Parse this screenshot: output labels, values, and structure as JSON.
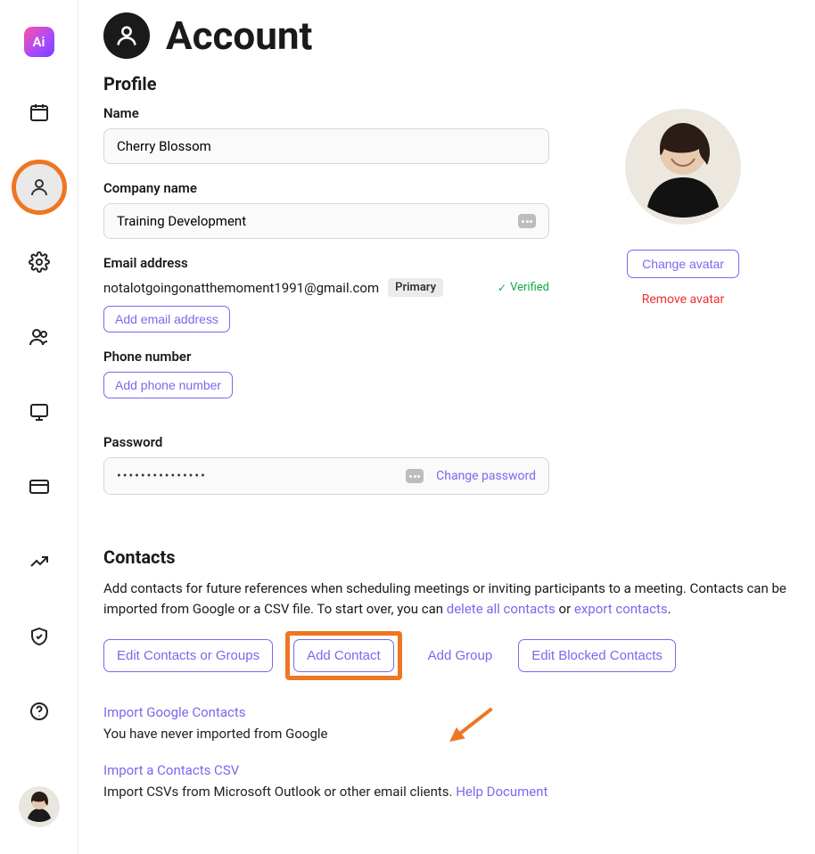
{
  "page": {
    "title": "Account"
  },
  "sidebar": {
    "logo_text": "Ai",
    "items": [
      {
        "name": "calendar"
      },
      {
        "name": "account",
        "active": true
      },
      {
        "name": "settings"
      },
      {
        "name": "people"
      },
      {
        "name": "display"
      },
      {
        "name": "billing"
      },
      {
        "name": "growth"
      },
      {
        "name": "security"
      },
      {
        "name": "help"
      }
    ]
  },
  "profile": {
    "heading": "Profile",
    "name_label": "Name",
    "name_value": "Cherry Blossom",
    "company_label": "Company name",
    "company_value": "Training Development",
    "email_label": "Email address",
    "email_value": "notalotgoingonatthemoment1991@gmail.com",
    "email_primary_badge": "Primary",
    "email_verified_text": "Verified",
    "add_email_btn": "Add email address",
    "phone_label": "Phone number",
    "add_phone_btn": "Add phone number",
    "password_label": "Password",
    "password_masked": "•••••••••••••••",
    "change_password_link": "Change password",
    "change_avatar_btn": "Change avatar",
    "remove_avatar_btn": "Remove avatar"
  },
  "contacts": {
    "heading": "Contacts",
    "desc_pre": "Add contacts for future references when scheduling meetings or inviting participants to a meeting. Contacts can be imported from Google or a CSV file. To start over, you can ",
    "delete_link": "delete all contacts",
    "or_text": " or ",
    "export_link": "export contacts",
    "period": ".",
    "btn_edit_groups": "Edit Contacts or Groups",
    "btn_add_contact": "Add Contact",
    "btn_add_group": "Add Group",
    "btn_edit_blocked": "Edit Blocked Contacts",
    "import_google_title": "Import Google Contacts",
    "import_google_sub": "You have never imported from Google",
    "import_csv_title": "Import a Contacts CSV",
    "import_csv_sub_pre": "Import CSVs from Microsoft Outlook or other email clients. ",
    "import_csv_help": "Help Document"
  }
}
